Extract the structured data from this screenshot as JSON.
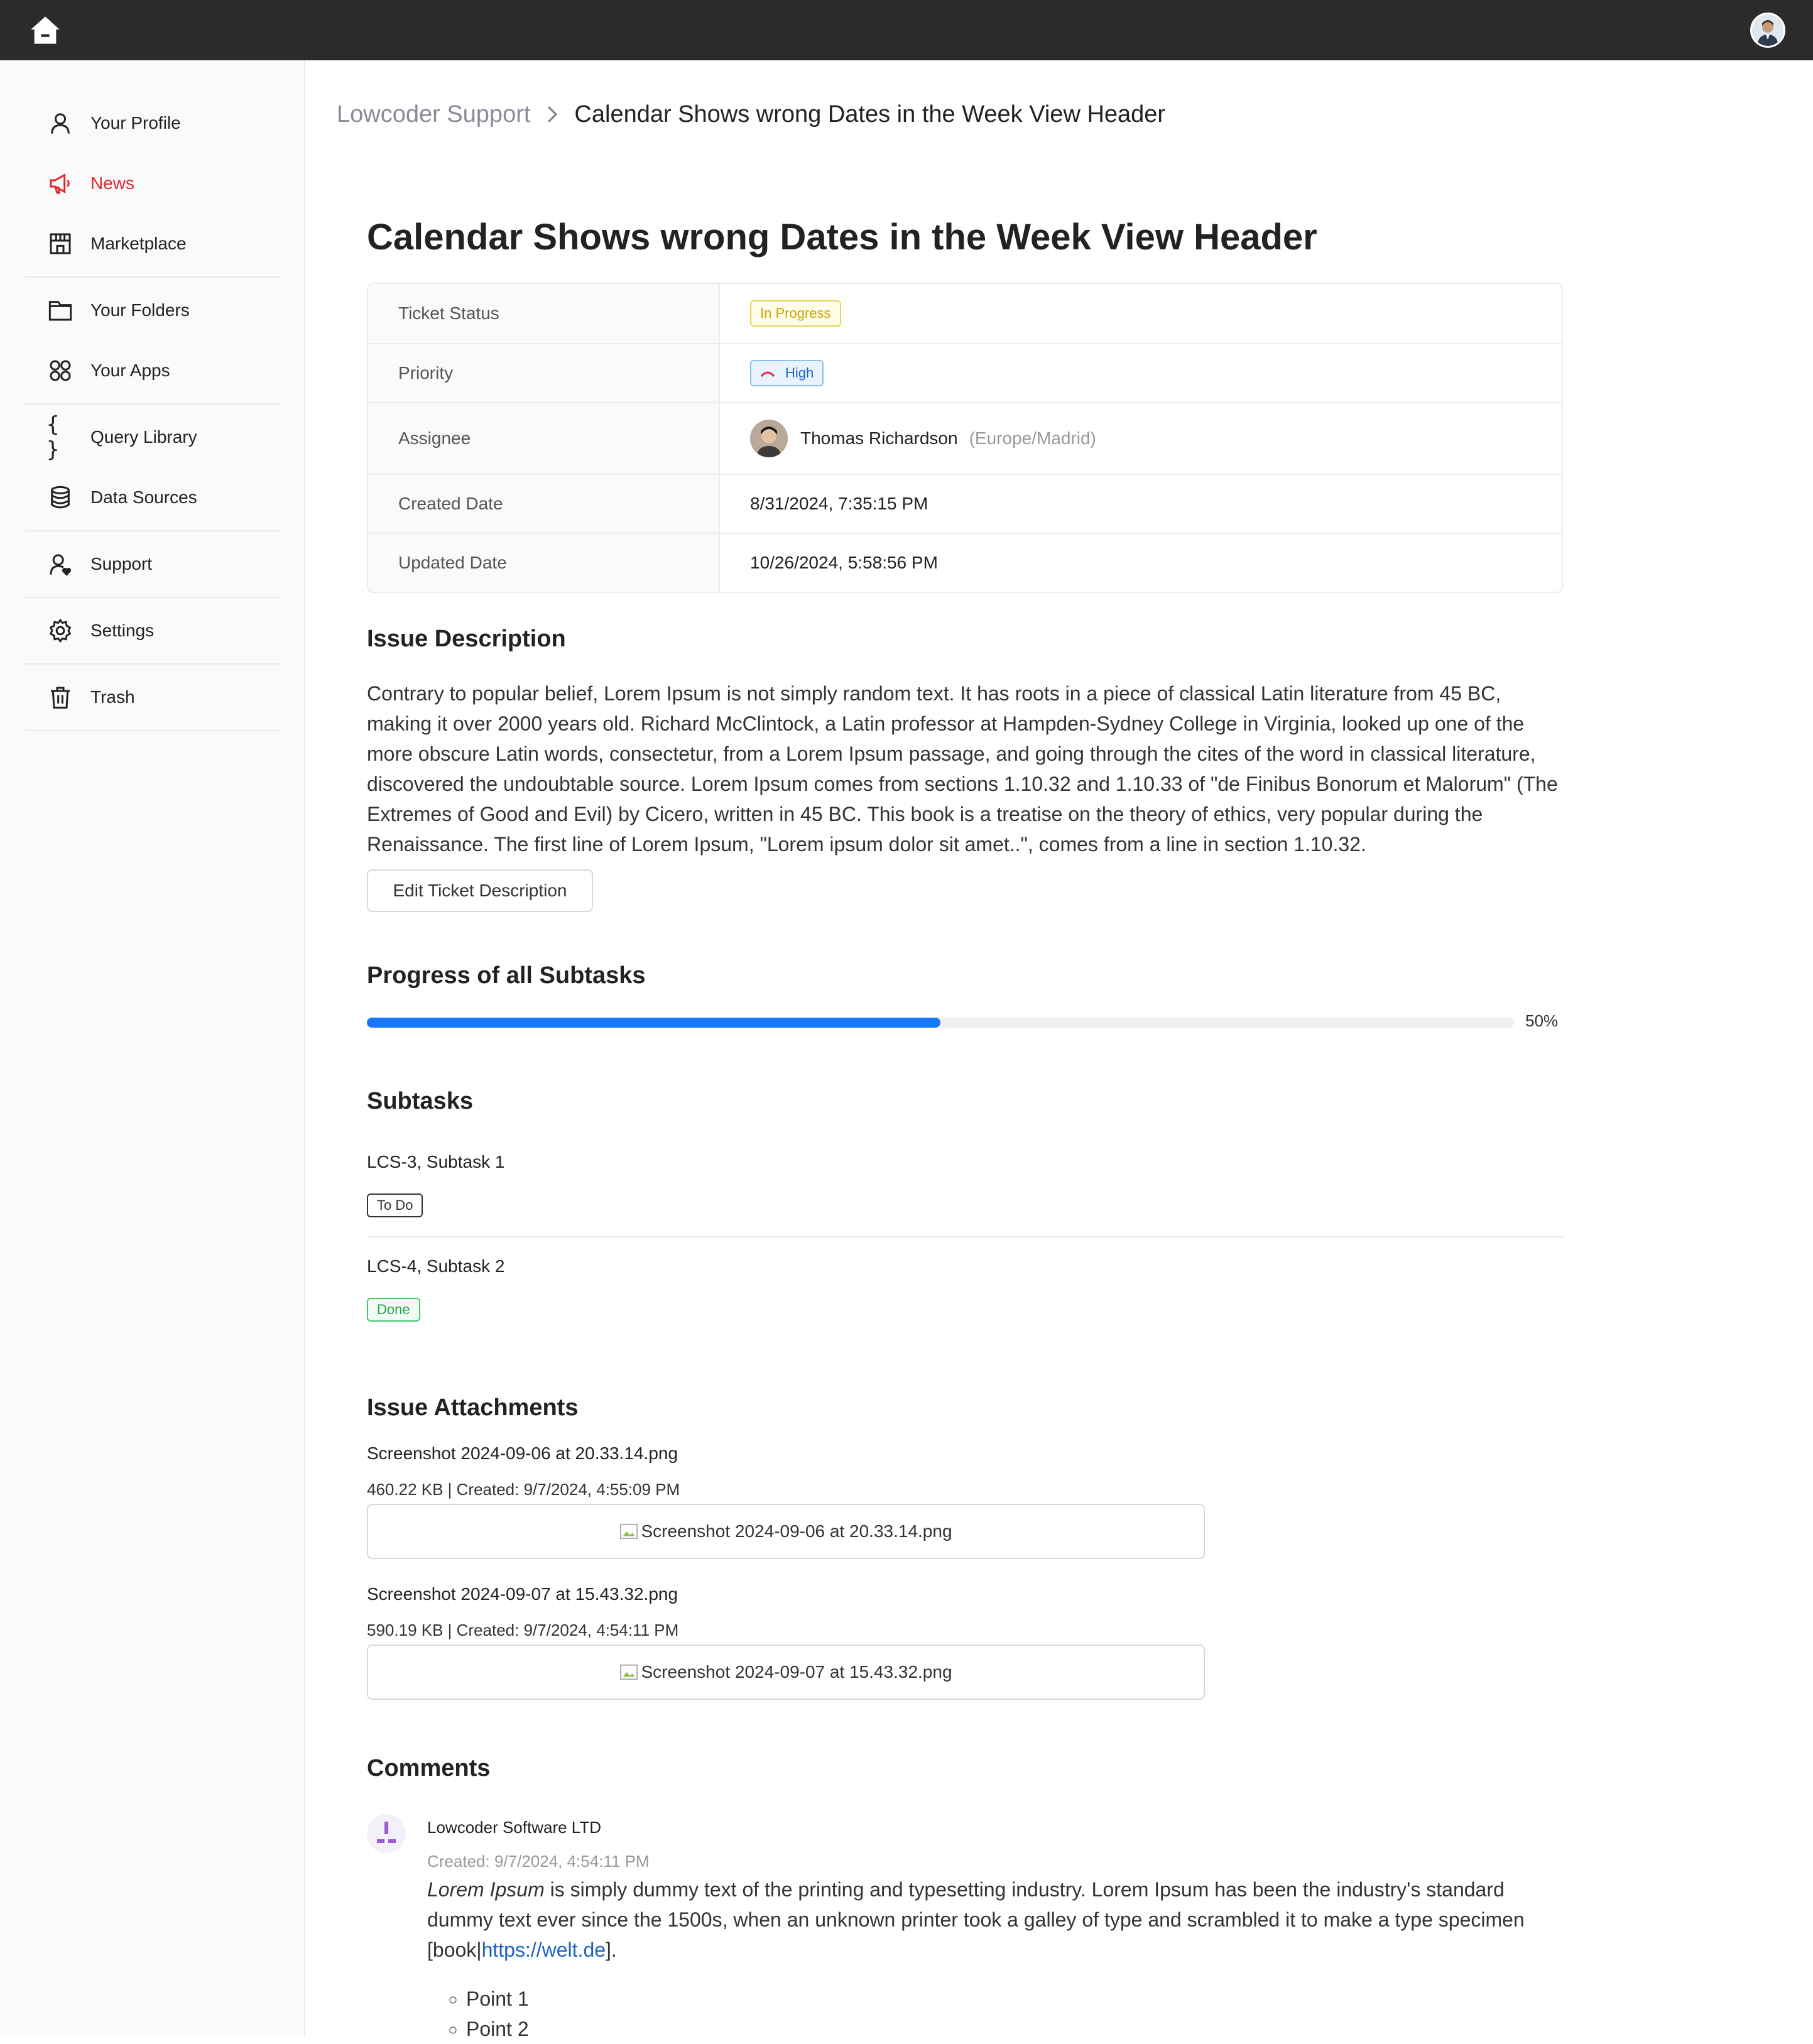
{
  "topbar": {
    "home_icon": "home-icon",
    "avatar_icon": "user-avatar"
  },
  "sidebar": {
    "items": [
      {
        "label": "Your Profile",
        "icon": "user-icon"
      },
      {
        "label": "News",
        "icon": "megaphone-icon",
        "active": true
      },
      {
        "label": "Marketplace",
        "icon": "store-icon"
      },
      {
        "label": "Your Folders",
        "icon": "folder-icon"
      },
      {
        "label": "Your Apps",
        "icon": "apps-icon"
      },
      {
        "label": "Query Library",
        "icon": "braces-icon"
      },
      {
        "label": "Data Sources",
        "icon": "database-icon"
      },
      {
        "label": "Support",
        "icon": "support-icon"
      },
      {
        "label": "Settings",
        "icon": "gear-icon"
      },
      {
        "label": "Trash",
        "icon": "trash-icon"
      }
    ]
  },
  "breadcrumb": {
    "parent": "Lowcoder Support",
    "current": "Calendar Shows wrong Dates in the Week View Header"
  },
  "ticket": {
    "title": "Calendar Shows wrong Dates in the Week View Header",
    "fields": {
      "status_label": "Ticket Status",
      "status_value": "In Progress",
      "priority_label": "Priority",
      "priority_value": "High",
      "assignee_label": "Assignee",
      "assignee_name": "Thomas Richardson",
      "assignee_tz": "(Europe/Madrid)",
      "created_label": "Created Date",
      "created_value": "8/31/2024, 7:35:15 PM",
      "updated_label": "Updated Date",
      "updated_value": "10/26/2024, 5:58:56 PM"
    }
  },
  "description": {
    "heading": "Issue Description",
    "text": "Contrary to popular belief, Lorem Ipsum is not simply random text. It has roots in a piece of classical Latin literature from 45 BC, making it over 2000 years old. Richard McClintock, a Latin professor at Hampden-Sydney College in Virginia, looked up one of the more obscure Latin words, consectetur, from a Lorem Ipsum passage, and going through the cites of the word in classical literature, discovered the undoubtable source. Lorem Ipsum comes from sections 1.10.32 and 1.10.33 of \"de Finibus Bonorum et Malorum\" (The Extremes of Good and Evil) by Cicero, written in 45 BC. This book is a treatise on the theory of ethics, very popular during the Renaissance. The first line of Lorem Ipsum, \"Lorem ipsum dolor sit amet..\", comes from a line in section 1.10.32.",
    "edit_button": "Edit Ticket Description"
  },
  "progress": {
    "heading": "Progress of all Subtasks",
    "percent": 50,
    "label": "50%"
  },
  "subtasks": {
    "heading": "Subtasks",
    "items": [
      {
        "title": "LCS-3, Subtask 1",
        "status": "To Do"
      },
      {
        "title": "LCS-4, Subtask 2",
        "status": "Done"
      }
    ]
  },
  "attachments": {
    "heading": "Issue Attachments",
    "items": [
      {
        "name": "Screenshot 2024-09-06 at 20.33.14.png",
        "meta": "460.22 KB | Created: 9/7/2024, 4:55:09 PM",
        "alt": "Screenshot 2024-09-06 at 20.33.14.png"
      },
      {
        "name": "Screenshot 2024-09-07 at 15.43.32.png",
        "meta": "590.19 KB | Created: 9/7/2024, 4:54:11 PM",
        "alt": "Screenshot 2024-09-07 at 15.43.32.png"
      }
    ]
  },
  "comments": {
    "heading": "Comments",
    "items": [
      {
        "author": "Lowcoder Software LTD",
        "created": "Created: 9/7/2024, 4:54:11 PM",
        "body_italic": "Lorem Ipsum",
        "body_text": " is simply dummy text of the printing and typesetting industry. Lorem Ipsum has been the industry's standard dummy text ever since the 1500s, when an unknown printer took a galley of type and scrambled it to make a type specimen [book|",
        "body_link": "https://welt.de",
        "body_end": "].",
        "points": [
          "Point 1",
          "Point 2"
        ]
      }
    ]
  },
  "colors": {
    "accent": "#1677ff",
    "active_nav": "#e0272d",
    "topbar": "#2b2b2b"
  }
}
